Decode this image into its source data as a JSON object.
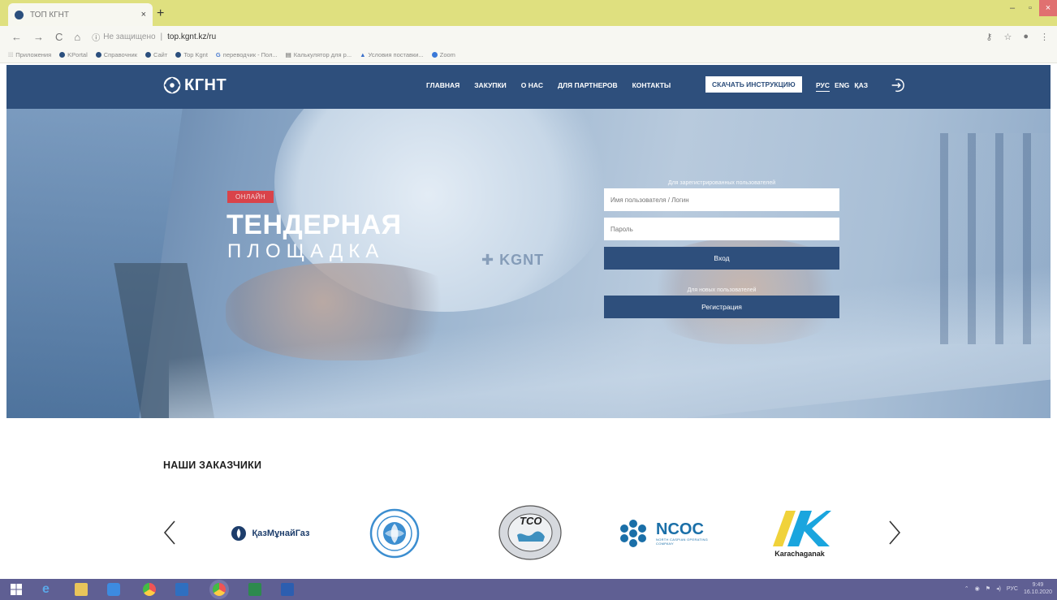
{
  "browser": {
    "tab_title": "ТОП КГНТ",
    "tab_close": "×",
    "new_tab": "+",
    "window_controls": [
      "–",
      "▫",
      "×"
    ],
    "nav_buttons": [
      "←",
      "→",
      "C",
      "⌂"
    ],
    "security_label": "Не защищено",
    "url": "top.kgnt.kz/ru",
    "bookmarks": [
      "Приложения",
      "KPortal",
      "Справочник",
      "Сайт",
      "Top Kgnt",
      "переводчик - Пол...",
      "Калькулятор для р...",
      "Условия поставки...",
      "Zoom"
    ]
  },
  "header": {
    "logo_text": "КГНТ",
    "nav": [
      "ГЛАВНАЯ",
      "ЗАКУПКИ",
      "О НАС",
      "ДЛЯ ПАРТНЕРОВ",
      "КОНТАКТЫ"
    ],
    "download_button": "СКАЧАТЬ ИНСТРУКЦИЮ",
    "languages": [
      "РУС",
      "ENG",
      "ҚАЗ"
    ]
  },
  "hero": {
    "badge": "ОНЛАЙН",
    "title": "ТЕНДЕРНАЯ",
    "subtitle": "ПЛОЩАДКА",
    "login": {
      "caption_registered": "Для зарегистрированных пользователей",
      "username_placeholder": "Имя пользователя / Логин",
      "password_placeholder": "Пароль",
      "login_button": "Вход",
      "caption_new": "Для новых пользователей",
      "register_button": "Регистрация"
    }
  },
  "customers": {
    "title": "НАШИ ЗАКАЗЧИКИ",
    "logos": [
      {
        "name": "kazmunaygas",
        "text": "ҚазМұнайГаз"
      },
      {
        "name": "seal",
        "text": ""
      },
      {
        "name": "tco",
        "text": "TCO"
      },
      {
        "name": "ncoc",
        "text": "NCOC",
        "subtext": "NORTH CASPIAN OPERATING COMPANY"
      },
      {
        "name": "karachaganak",
        "text": "Karachaganak"
      }
    ]
  },
  "taskbar": {
    "lang": "РУС",
    "time": "9:49",
    "date": "16.10.2020"
  },
  "colors": {
    "brand_blue": "#2e4f7c",
    "badge_red": "#d9434a",
    "tab_bar": "#dfe07f",
    "taskbar": "#5f5f93"
  }
}
